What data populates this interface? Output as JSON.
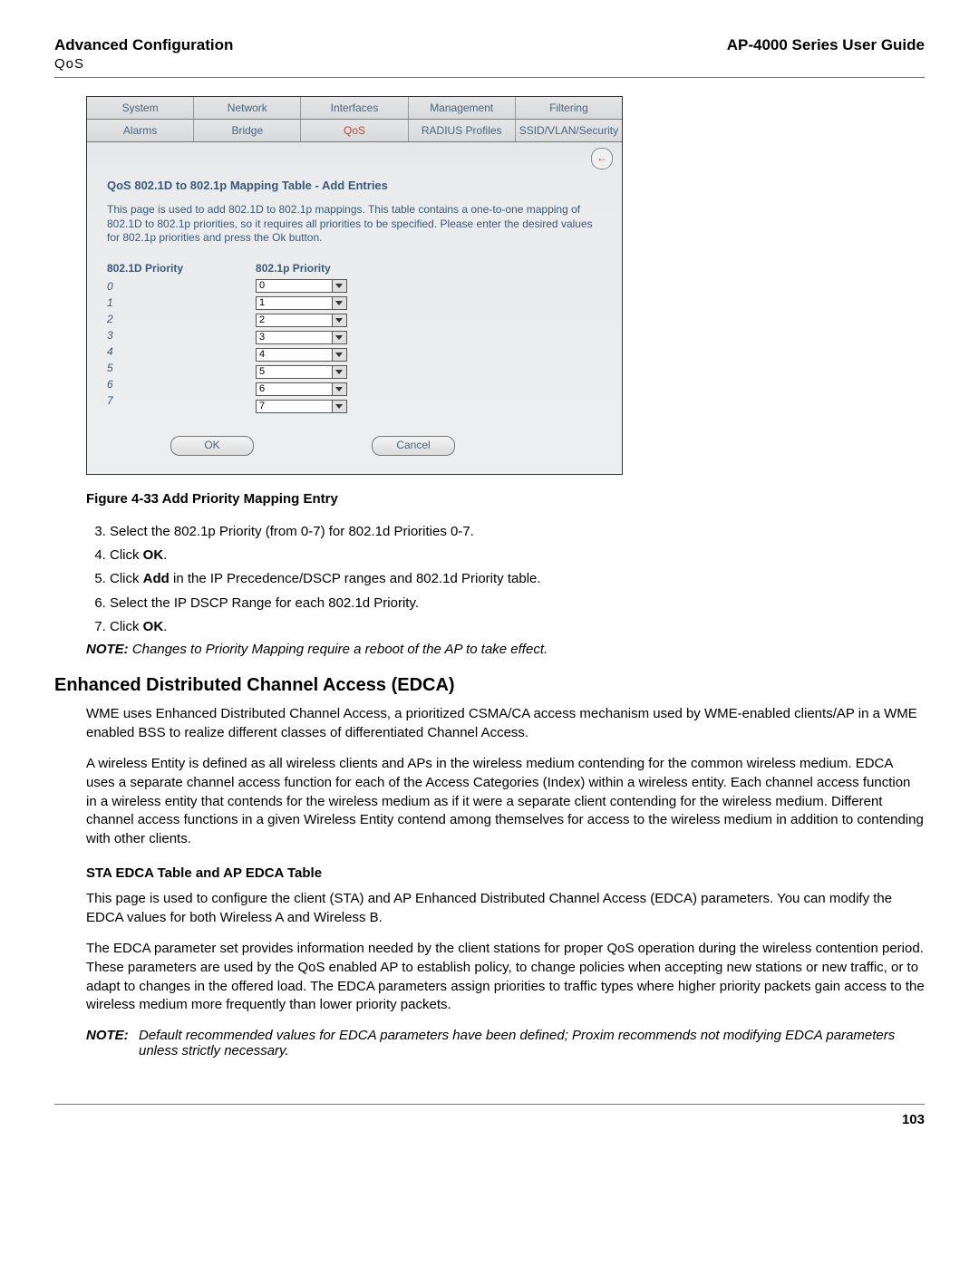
{
  "header": {
    "left_title": "Advanced Configuration",
    "left_sub": "QoS",
    "right_title": "AP-4000 Series User Guide"
  },
  "screenshot": {
    "tabs_row1": [
      "System",
      "Network",
      "Interfaces",
      "Management",
      "Filtering"
    ],
    "tabs_row2": [
      "Alarms",
      "Bridge",
      "QoS",
      "RADIUS Profiles",
      "SSID/VLAN/Security"
    ],
    "active_tab": "QoS",
    "back_arrow": "←",
    "panel_title": "QoS 802.1D to 802.1p Mapping Table - Add Entries",
    "panel_desc": "This page is used to add 802.1D to 802.1p mappings. This table contains a one-to-one mapping of 802.1D to 802.1p priorities, so it requires all priorities to be specified. Please enter the desired values for 802.1p priorities and press the Ok button.",
    "col1_header": "802.1D Priority",
    "col2_header": "802.1p Priority",
    "priorities_d": [
      "0",
      "1",
      "2",
      "3",
      "4",
      "5",
      "6",
      "7"
    ],
    "priorities_p": [
      "0",
      "1",
      "2",
      "3",
      "4",
      "5",
      "6",
      "7"
    ],
    "ok_label": "OK",
    "cancel_label": "Cancel"
  },
  "figure_caption": "Figure 4-33 Add Priority Mapping Entry",
  "steps": {
    "start": 3,
    "items": [
      "Select the 802.1p Priority (from 0-7) for 802.1d Priorities 0-7.",
      "Click OK.",
      "Click Add in the IP Precedence/DSCP ranges and 802.1d Priority table.",
      "Select the IP DSCP Range for each 802.1d Priority.",
      "Click OK."
    ],
    "bold_ok": "OK",
    "bold_add": "Add"
  },
  "note1": {
    "label": "NOTE:",
    "text": "Changes to Priority Mapping require a reboot of the AP to take effect."
  },
  "edca": {
    "heading": "Enhanced Distributed Channel Access (EDCA)",
    "para1": "WME uses Enhanced Distributed Channel Access, a prioritized CSMA/CA access mechanism used by WME-enabled clients/AP in a WME enabled BSS to realize different classes of differentiated Channel Access.",
    "para2": "A wireless Entity is defined as all wireless clients and APs in the wireless medium contending for the common wireless medium. EDCA uses a separate channel access function for each of the Access Categories (Index) within a wireless entity. Each channel access function in a wireless entity that contends for the wireless medium as if it were a separate client contending for the wireless medium. Different channel access functions in a given Wireless Entity contend among themselves for access to the wireless medium in addition to contending with other clients.",
    "sub_heading": "STA EDCA Table and AP EDCA Table",
    "para3": "This page is used to configure the client (STA) and AP Enhanced Distributed Channel Access (EDCA) parameters. You can modify the EDCA values for both Wireless A and Wireless B.",
    "para4": "The EDCA parameter set provides information needed by the client stations for proper QoS operation during the wireless contention period. These parameters are used by the QoS enabled AP to establish policy, to change policies when accepting new stations or new traffic, or to adapt to changes in the offered load. The EDCA parameters assign priorities to traffic types where higher priority packets gain access to the wireless medium more frequently than lower priority packets."
  },
  "note2": {
    "label": "NOTE:",
    "text": "Default recommended values for EDCA parameters have been defined; Proxim recommends not modifying EDCA parameters unless strictly necessary."
  },
  "page_number": "103"
}
